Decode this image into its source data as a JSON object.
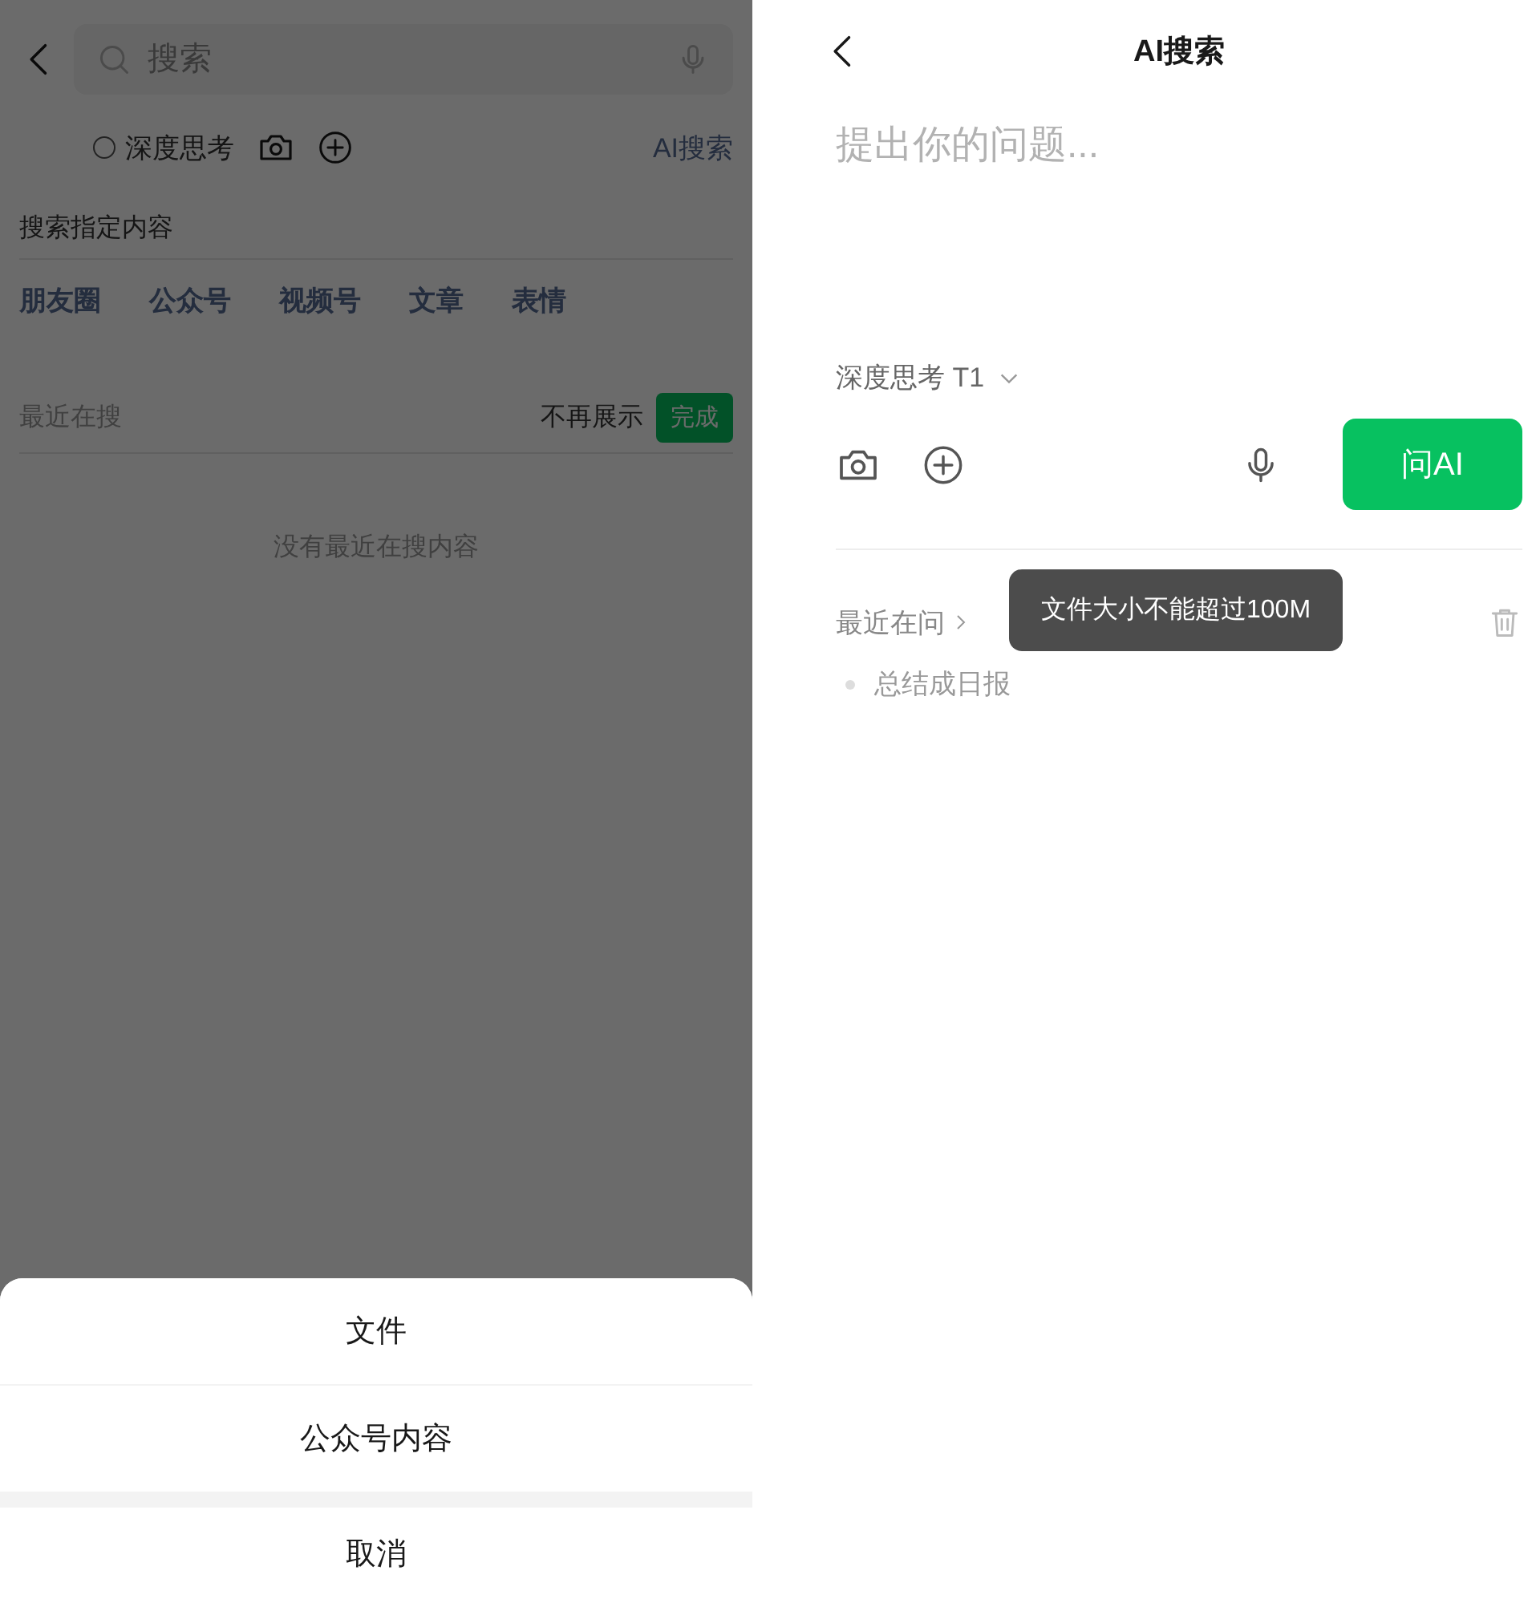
{
  "left_screen": {
    "search_field": {
      "placeholder": "搜索"
    },
    "deep_think": {
      "label": "深度思考",
      "checked": false
    },
    "ai_search_link": "AI搜索",
    "section_title": "搜索指定内容",
    "categories": [
      "朋友圈",
      "公众号",
      "视频号",
      "文章",
      "表情"
    ],
    "recent": {
      "title": "最近在搜",
      "hide_label": "不再展示",
      "done_button": "完成",
      "empty_text": "没有最近在搜内容"
    }
  },
  "action_sheet": {
    "items": [
      "文件",
      "公众号内容"
    ],
    "cancel": "取消"
  },
  "right_screen": {
    "title": "AI搜索",
    "question_field": {
      "placeholder": "提出你的问题..."
    },
    "model_selector": "深度思考 T1",
    "ask_button": "问AI",
    "recent": {
      "title": "最近在问",
      "items": [
        "总结成日报"
      ]
    },
    "toast": "文件大小不能超过100M"
  }
}
